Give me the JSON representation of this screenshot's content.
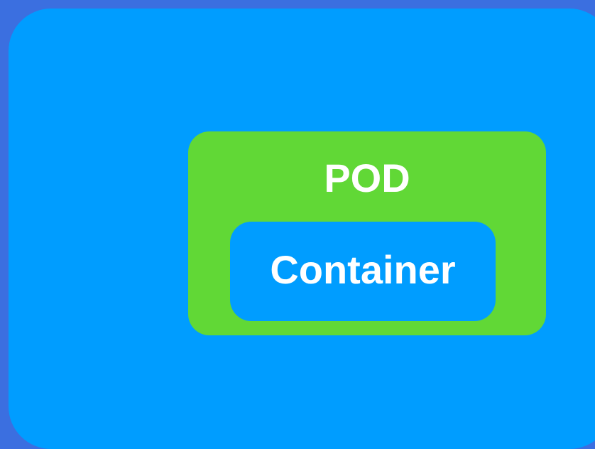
{
  "colors": {
    "background": "#3b6fe0",
    "outer_fill": "#009dff",
    "pod_fill": "#61d836",
    "container_fill": "#009dff",
    "text": "#ffffff"
  },
  "pod": {
    "label": "POD",
    "container": {
      "label": "Container"
    }
  }
}
